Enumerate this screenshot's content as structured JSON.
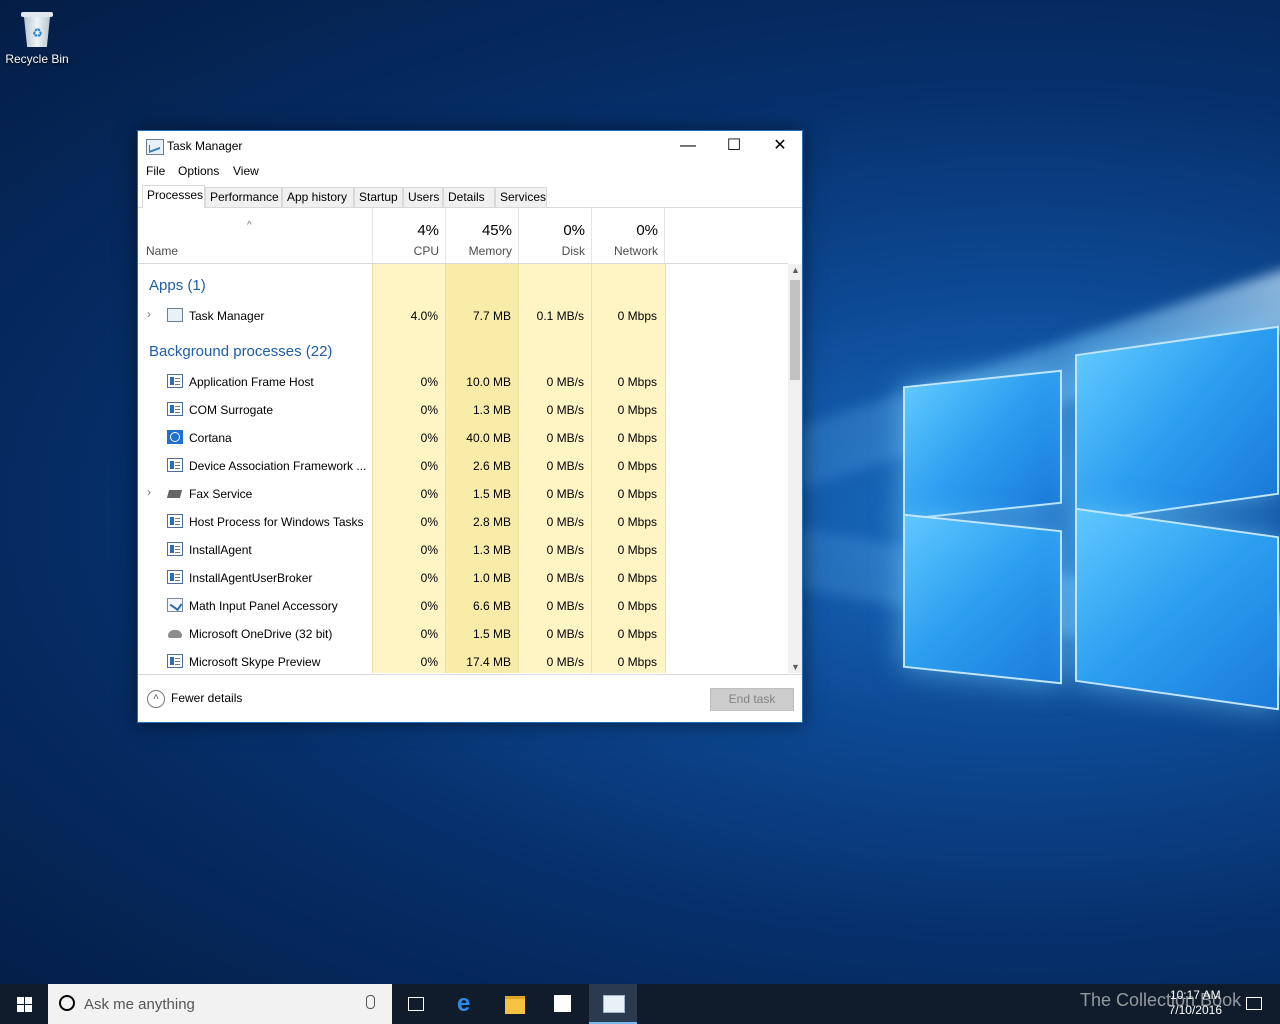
{
  "desktop": {
    "recycle_bin_label": "Recycle Bin"
  },
  "window": {
    "title": "Task Manager",
    "menu": [
      "File",
      "Options",
      "View"
    ],
    "tabs": [
      "Processes",
      "Performance",
      "App history",
      "Startup",
      "Users",
      "Details",
      "Services"
    ],
    "active_tab": "Processes",
    "columns": {
      "name": "Name",
      "cpu": {
        "label": "CPU",
        "pct": "4%"
      },
      "memory": {
        "label": "Memory",
        "pct": "45%"
      },
      "disk": {
        "label": "Disk",
        "pct": "0%"
      },
      "network": {
        "label": "Network",
        "pct": "0%"
      }
    },
    "groups": {
      "apps": "Apps (1)",
      "background": "Background processes (22)"
    },
    "apps": [
      {
        "name": "Task Manager",
        "icon": "task-manager-icon",
        "cpu": "4.0%",
        "memory": "7.7 MB",
        "disk": "0.1 MB/s",
        "network": "0 Mbps",
        "expandable": true
      }
    ],
    "background": [
      {
        "name": "Application Frame Host",
        "icon": "box",
        "cpu": "0%",
        "memory": "10.0 MB",
        "disk": "0 MB/s",
        "network": "0 Mbps"
      },
      {
        "name": "COM Surrogate",
        "icon": "box",
        "cpu": "0%",
        "memory": "1.3 MB",
        "disk": "0 MB/s",
        "network": "0 Mbps"
      },
      {
        "name": "Cortana",
        "icon": "cortana",
        "cpu": "0%",
        "memory": "40.0 MB",
        "disk": "0 MB/s",
        "network": "0 Mbps"
      },
      {
        "name": "Device Association Framework ...",
        "icon": "box",
        "cpu": "0%",
        "memory": "2.6 MB",
        "disk": "0 MB/s",
        "network": "0 Mbps"
      },
      {
        "name": "Fax Service",
        "icon": "fax",
        "cpu": "0%",
        "memory": "1.5 MB",
        "disk": "0 MB/s",
        "network": "0 Mbps",
        "expandable": true
      },
      {
        "name": "Host Process for Windows Tasks",
        "icon": "box",
        "cpu": "0%",
        "memory": "2.8 MB",
        "disk": "0 MB/s",
        "network": "0 Mbps"
      },
      {
        "name": "InstallAgent",
        "icon": "box",
        "cpu": "0%",
        "memory": "1.3 MB",
        "disk": "0 MB/s",
        "network": "0 Mbps"
      },
      {
        "name": "InstallAgentUserBroker",
        "icon": "box",
        "cpu": "0%",
        "memory": "1.0 MB",
        "disk": "0 MB/s",
        "network": "0 Mbps"
      },
      {
        "name": "Math Input Panel Accessory",
        "icon": "math",
        "cpu": "0%",
        "memory": "6.6 MB",
        "disk": "0 MB/s",
        "network": "0 Mbps"
      },
      {
        "name": "Microsoft OneDrive (32 bit)",
        "icon": "cloud",
        "cpu": "0%",
        "memory": "1.5 MB",
        "disk": "0 MB/s",
        "network": "0 Mbps"
      },
      {
        "name": "Microsoft Skype Preview",
        "icon": "box",
        "cpu": "0%",
        "memory": "17.4 MB",
        "disk": "0 MB/s",
        "network": "0 Mbps"
      }
    ],
    "footer": {
      "fewer_details": "Fewer details",
      "end_task": "End task"
    }
  },
  "taskbar": {
    "search_placeholder": "Ask me anything",
    "clock_time": "10:17 AM",
    "clock_date": "7/10/2016",
    "watermark": "The Collection Book"
  },
  "colors": {
    "accent": "#1f5ea8",
    "heat_light": "#fff4c4",
    "heat_medium": "#f9eca8",
    "taskbar": "#101c2c"
  }
}
